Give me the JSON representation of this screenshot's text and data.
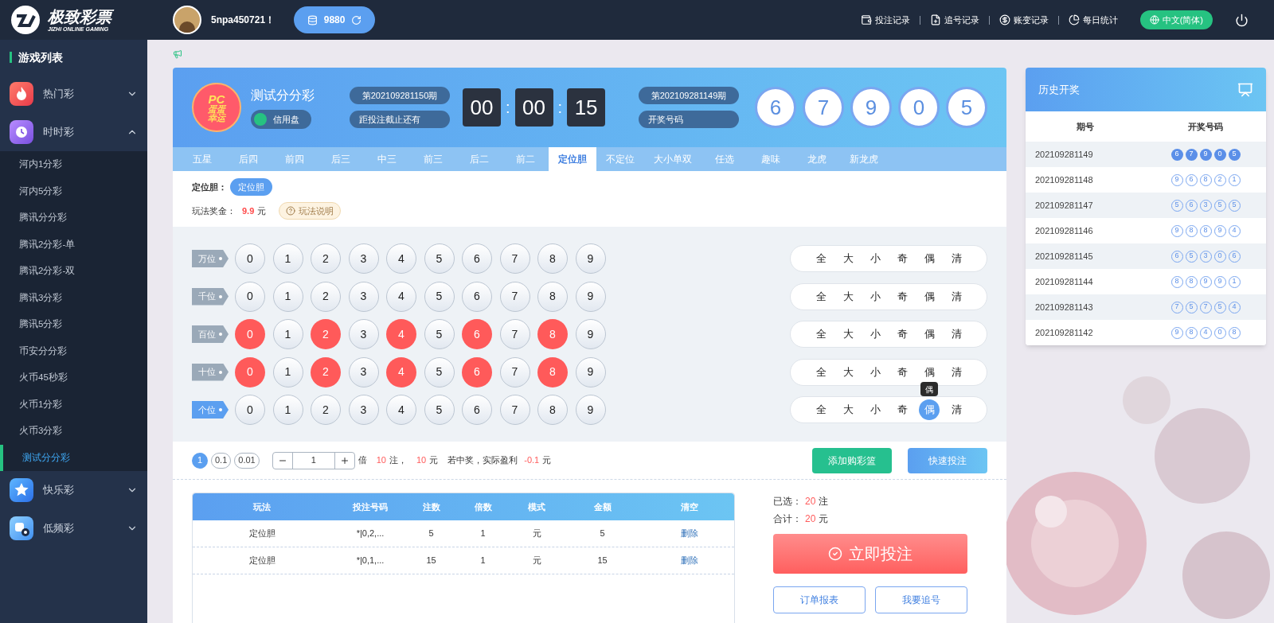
{
  "brand": {
    "name": "极致彩票",
    "tagline": "JIZHI ONLINE GAMING"
  },
  "user": {
    "name": "5npa450721！",
    "balance": "9880"
  },
  "top_links": [
    {
      "label": "投注记录"
    },
    {
      "label": "追号记录"
    },
    {
      "label": "账变记录"
    },
    {
      "label": "每日统计"
    }
  ],
  "language": "中文(简体)",
  "sidebar": {
    "title": "游戏列表",
    "groups": [
      {
        "label": "热门彩",
        "expanded": false
      },
      {
        "label": "时时彩",
        "expanded": true,
        "children": [
          {
            "label": "河内1分彩",
            "selected": false
          },
          {
            "label": "河内5分彩",
            "selected": false
          },
          {
            "label": "腾讯分分彩",
            "selected": false
          },
          {
            "label": "腾讯2分彩-单",
            "selected": false
          },
          {
            "label": "腾讯2分彩-双",
            "selected": false
          },
          {
            "label": "腾讯3分彩",
            "selected": false
          },
          {
            "label": "腾讯5分彩",
            "selected": false
          },
          {
            "label": "币安分分彩",
            "selected": false
          },
          {
            "label": "火币45秒彩",
            "selected": false
          },
          {
            "label": "火币1分彩",
            "selected": false
          },
          {
            "label": "火币3分彩",
            "selected": false
          },
          {
            "label": "测试分分彩",
            "selected": true
          }
        ]
      },
      {
        "label": "快乐彩",
        "expanded": false
      },
      {
        "label": "低频彩",
        "expanded": false
      }
    ]
  },
  "game": {
    "logo_lines": [
      "PC",
      "蛋蛋",
      "幸运"
    ],
    "name": "测试分分彩",
    "mode": "信用盘",
    "current_issue": "第202109281150期",
    "deadline_label": "距投注截止还有",
    "countdown": [
      "00",
      "00",
      "15"
    ],
    "countdown_separator": ":",
    "last_issue": "第202109281149期",
    "result_label": "开奖号码",
    "result": [
      "6",
      "7",
      "9",
      "0",
      "5"
    ]
  },
  "play_tabs": [
    {
      "label": "五星",
      "selected": false
    },
    {
      "label": "后四",
      "selected": false
    },
    {
      "label": "前四",
      "selected": false
    },
    {
      "label": "后三",
      "selected": false
    },
    {
      "label": "中三",
      "selected": false
    },
    {
      "label": "前三",
      "selected": false
    },
    {
      "label": "后二",
      "selected": false
    },
    {
      "label": "前二",
      "selected": false
    },
    {
      "label": "定位胆",
      "selected": true
    },
    {
      "label": "不定位",
      "selected": false
    },
    {
      "label": "大小单双",
      "selected": false
    },
    {
      "label": "任选",
      "selected": false
    },
    {
      "label": "趣味",
      "selected": false
    },
    {
      "label": "龙虎",
      "selected": false
    },
    {
      "label": "新龙虎",
      "selected": false
    }
  ],
  "sub_play": {
    "label": "定位胆：",
    "options": [
      {
        "label": "定位胆",
        "selected": true
      }
    ]
  },
  "prize": {
    "label": "玩法奖金：",
    "amount": "9.9",
    "unit": "元",
    "help": "玩法说明"
  },
  "positions": [
    {
      "label": "万位",
      "selected": false,
      "balls": [
        {
          "n": "0",
          "selected": false
        },
        {
          "n": "1",
          "selected": false
        },
        {
          "n": "2",
          "selected": false
        },
        {
          "n": "3",
          "selected": false
        },
        {
          "n": "4",
          "selected": false
        },
        {
          "n": "5",
          "selected": false
        },
        {
          "n": "6",
          "selected": false
        },
        {
          "n": "7",
          "selected": false
        },
        {
          "n": "8",
          "selected": false
        },
        {
          "n": "9",
          "selected": false
        }
      ],
      "quick": [
        {
          "label": "全",
          "selected": false
        },
        {
          "label": "大",
          "selected": false
        },
        {
          "label": "小",
          "selected": false
        },
        {
          "label": "奇",
          "selected": false
        },
        {
          "label": "偶",
          "selected": false
        },
        {
          "label": "清",
          "selected": false
        }
      ]
    },
    {
      "label": "千位",
      "selected": false,
      "balls": [
        {
          "n": "0",
          "selected": false
        },
        {
          "n": "1",
          "selected": false
        },
        {
          "n": "2",
          "selected": false
        },
        {
          "n": "3",
          "selected": false
        },
        {
          "n": "4",
          "selected": false
        },
        {
          "n": "5",
          "selected": false
        },
        {
          "n": "6",
          "selected": false
        },
        {
          "n": "7",
          "selected": false
        },
        {
          "n": "8",
          "selected": false
        },
        {
          "n": "9",
          "selected": false
        }
      ],
      "quick": [
        {
          "label": "全",
          "selected": false
        },
        {
          "label": "大",
          "selected": false
        },
        {
          "label": "小",
          "selected": false
        },
        {
          "label": "奇",
          "selected": false
        },
        {
          "label": "偶",
          "selected": false
        },
        {
          "label": "清",
          "selected": false
        }
      ]
    },
    {
      "label": "百位",
      "selected": false,
      "balls": [
        {
          "n": "0",
          "selected": true
        },
        {
          "n": "1",
          "selected": false
        },
        {
          "n": "2",
          "selected": true
        },
        {
          "n": "3",
          "selected": false
        },
        {
          "n": "4",
          "selected": true
        },
        {
          "n": "5",
          "selected": false
        },
        {
          "n": "6",
          "selected": true
        },
        {
          "n": "7",
          "selected": false
        },
        {
          "n": "8",
          "selected": true
        },
        {
          "n": "9",
          "selected": false
        }
      ],
      "quick": [
        {
          "label": "全",
          "selected": false
        },
        {
          "label": "大",
          "selected": false
        },
        {
          "label": "小",
          "selected": false
        },
        {
          "label": "奇",
          "selected": false
        },
        {
          "label": "偶",
          "selected": false
        },
        {
          "label": "清",
          "selected": false
        }
      ]
    },
    {
      "label": "十位",
      "selected": false,
      "balls": [
        {
          "n": "0",
          "selected": true
        },
        {
          "n": "1",
          "selected": false
        },
        {
          "n": "2",
          "selected": true
        },
        {
          "n": "3",
          "selected": false
        },
        {
          "n": "4",
          "selected": true
        },
        {
          "n": "5",
          "selected": false
        },
        {
          "n": "6",
          "selected": true
        },
        {
          "n": "7",
          "selected": false
        },
        {
          "n": "8",
          "selected": true
        },
        {
          "n": "9",
          "selected": false
        }
      ],
      "quick": [
        {
          "label": "全",
          "selected": false
        },
        {
          "label": "大",
          "selected": false
        },
        {
          "label": "小",
          "selected": false
        },
        {
          "label": "奇",
          "selected": false
        },
        {
          "label": "偶",
          "selected": false
        },
        {
          "label": "清",
          "selected": false
        }
      ]
    },
    {
      "label": "个位",
      "selected": true,
      "balls": [
        {
          "n": "0",
          "selected": false
        },
        {
          "n": "1",
          "selected": false
        },
        {
          "n": "2",
          "selected": false
        },
        {
          "n": "3",
          "selected": false
        },
        {
          "n": "4",
          "selected": false
        },
        {
          "n": "5",
          "selected": false
        },
        {
          "n": "6",
          "selected": false
        },
        {
          "n": "7",
          "selected": false
        },
        {
          "n": "8",
          "selected": false
        },
        {
          "n": "9",
          "selected": false
        }
      ],
      "quick": [
        {
          "label": "全",
          "selected": false
        },
        {
          "label": "大",
          "selected": false
        },
        {
          "label": "小",
          "selected": false
        },
        {
          "label": "奇",
          "selected": false
        },
        {
          "label": "偶",
          "selected": true,
          "tooltip": "偶"
        },
        {
          "label": "清",
          "selected": false
        }
      ]
    }
  ],
  "units": [
    {
      "label": "1",
      "selected": true
    },
    {
      "label": "0.1",
      "selected": false
    },
    {
      "label": "0.01",
      "selected": false
    }
  ],
  "multiplier": {
    "value": "1",
    "label": "倍"
  },
  "summary": {
    "bets": "10",
    "bets_unit": "注，",
    "amount": "10",
    "amount_unit": "元",
    "profit_label": "若中奖，实际盈利",
    "profit": "-0.1",
    "profit_unit": "元"
  },
  "buttons": {
    "add_to_basket": "添加购彩篮",
    "quick_bet": "快速投注"
  },
  "cart": {
    "columns": [
      "玩法",
      "投注号码",
      "注数",
      "倍数",
      "模式",
      "金额",
      "清空"
    ],
    "rows": [
      [
        "定位胆",
        "*|0,2,...",
        "5",
        "1",
        "元",
        "5",
        "删除"
      ],
      [
        "定位胆",
        "*|0,1,...",
        "15",
        "1",
        "元",
        "15",
        "删除"
      ]
    ]
  },
  "totals": {
    "selected_label": "已选：",
    "selected": "20",
    "selected_unit": "注",
    "total_label": "合计：",
    "total": "20",
    "total_unit": "元"
  },
  "submit": "立即投注",
  "actions": [
    "订单报表",
    "我要追号"
  ],
  "history": {
    "title": "历史开奖",
    "columns": [
      "期号",
      "开奖号码"
    ],
    "rows": [
      {
        "issue": "202109281149",
        "latest": true,
        "balls": [
          "6",
          "7",
          "9",
          "0",
          "5"
        ]
      },
      {
        "issue": "202109281148",
        "latest": false,
        "balls": [
          "9",
          "6",
          "8",
          "2",
          "1"
        ]
      },
      {
        "issue": "202109281147",
        "latest": false,
        "balls": [
          "5",
          "6",
          "3",
          "5",
          "5"
        ]
      },
      {
        "issue": "202109281146",
        "latest": false,
        "balls": [
          "9",
          "8",
          "8",
          "9",
          "4"
        ]
      },
      {
        "issue": "202109281145",
        "latest": false,
        "balls": [
          "6",
          "5",
          "3",
          "0",
          "6"
        ]
      },
      {
        "issue": "202109281144",
        "latest": false,
        "balls": [
          "8",
          "8",
          "9",
          "9",
          "1"
        ]
      },
      {
        "issue": "202109281143",
        "latest": false,
        "balls": [
          "7",
          "5",
          "7",
          "5",
          "4"
        ]
      },
      {
        "issue": "202109281142",
        "latest": false,
        "balls": [
          "9",
          "8",
          "4",
          "0",
          "8"
        ]
      }
    ]
  }
}
